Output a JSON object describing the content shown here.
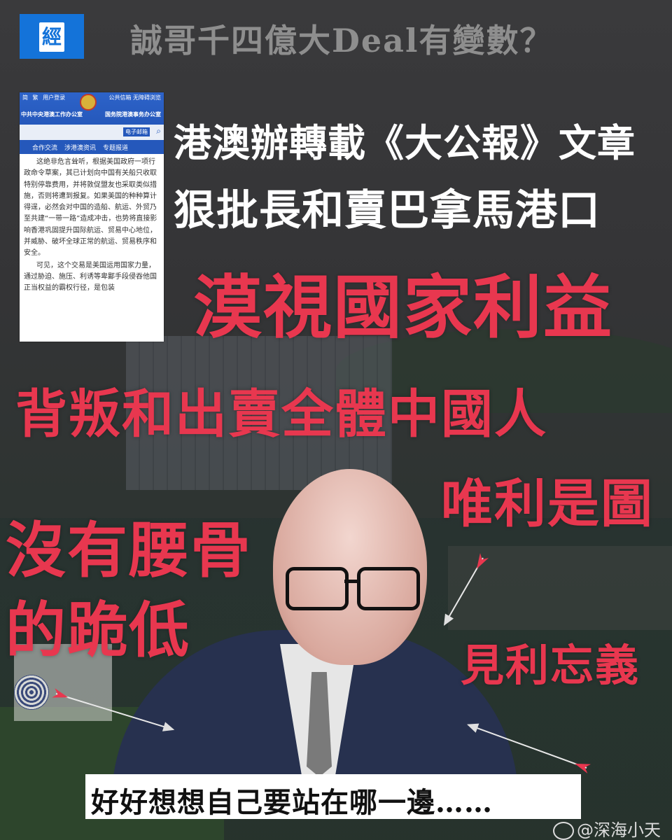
{
  "header": {
    "logo_char": "經",
    "headline": "誠哥千四億大Deal有變數？"
  },
  "screenshot": {
    "top_links_left": [
      "简",
      "繁",
      "用户登录"
    ],
    "top_links_right": "公共信箱  无障碍浏览",
    "office_left": "中共中央港澳工作办公室",
    "office_right": "国务院港澳事务办公室",
    "email_label": "电子邮箱",
    "nav": [
      "合作交流",
      "涉港澳资讯",
      "专题报道"
    ],
    "paragraphs": [
      "这绝非危言耸听，根据美国政府一项行政命令草案，其已计划向中国有关船只收取特别停靠费用，并将敦促盟友也采取类似措施，否则将遭到报复。如果美国的种种算计得逞，必然会对中国的造船、航运、外贸乃至共建“一带一路”造成冲击，也势将直接影响香港巩固提升国际航运、贸易中心地位，并威胁、破坏全球正常的航运、贸易秩序和安全。",
      "可见，这个交易是美国运用国家力量，通过胁迫、施压、利诱等卑鄙手段侵吞他国正当权益的霸权行径，是包装"
    ]
  },
  "white_headlines": [
    "港澳辦轉載《大公報》文章",
    "狠批長和賣巴拿馬港口"
  ],
  "red_phrases": {
    "p1": "漠視國家利益",
    "p2": "背叛和出賣全體中國人",
    "p3": "唯利是圖",
    "p4a": "沒有腰骨",
    "p4b": "的跪低",
    "p5": "見利忘義"
  },
  "caption": "好好想想自己要站在哪一邊……",
  "watermark": "@深海小天",
  "colors": {
    "accent_red": "#e8374f",
    "logo_blue": "#1473d9",
    "site_blue": "#2558bb"
  }
}
